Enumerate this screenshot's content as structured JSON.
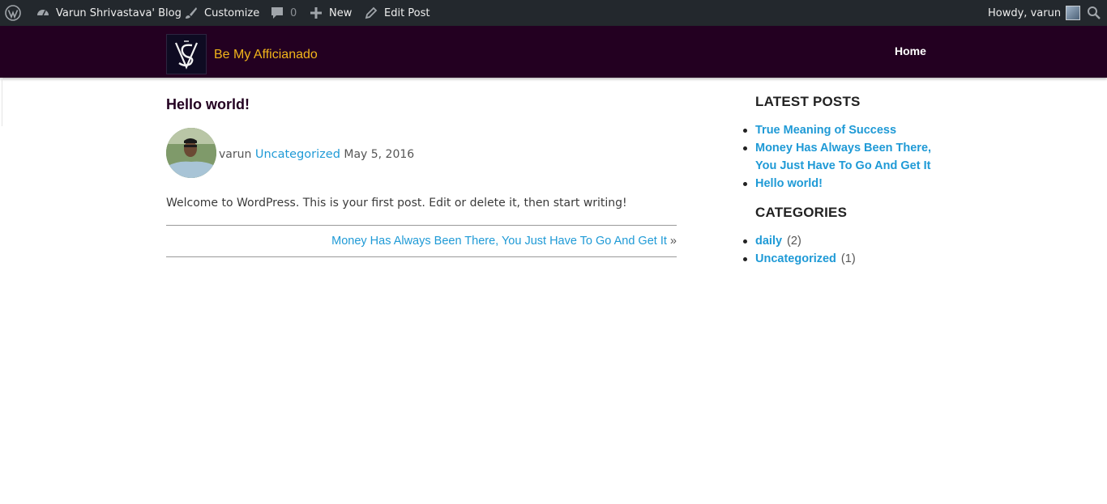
{
  "admin_bar": {
    "site_name": "Varun Shrivastava' Blog",
    "customize": "Customize",
    "comments_count": "0",
    "new": "New",
    "edit_post": "Edit Post",
    "howdy": "Howdy, varun",
    "icons": [
      "wordpress-icon",
      "dashboard-icon",
      "brush-icon",
      "comment-icon",
      "plus-icon",
      "pencil-icon",
      "avatar",
      "search-icon"
    ]
  },
  "header": {
    "site_title": "Be My Afficianado",
    "nav_home": "Home",
    "colors": {
      "background": "#230021",
      "title": "#f2b51a"
    }
  },
  "post": {
    "title": "Hello world!",
    "author": "varun",
    "category": "Uncategorized",
    "date": "May 5, 2016",
    "body": "Welcome to WordPress. This is your first post. Edit or delete it, then start writing!",
    "next_post": "Money Has Always Been There, You Just Have To Go And Get It",
    "next_arrow": "»"
  },
  "sidebar": {
    "latest_title": "LATEST POSTS",
    "latest_posts": [
      "True Meaning of Success",
      "Money Has Always Been There, You Just Have To Go And Get It",
      "Hello world!"
    ],
    "categories_title": "CATEGORIES",
    "categories": [
      {
        "name": "daily",
        "count": "(2)"
      },
      {
        "name": "Uncategorized",
        "count": "(1)"
      }
    ]
  },
  "colors": {
    "link": "#1f9ad6",
    "admin_bar": "#23282d"
  }
}
